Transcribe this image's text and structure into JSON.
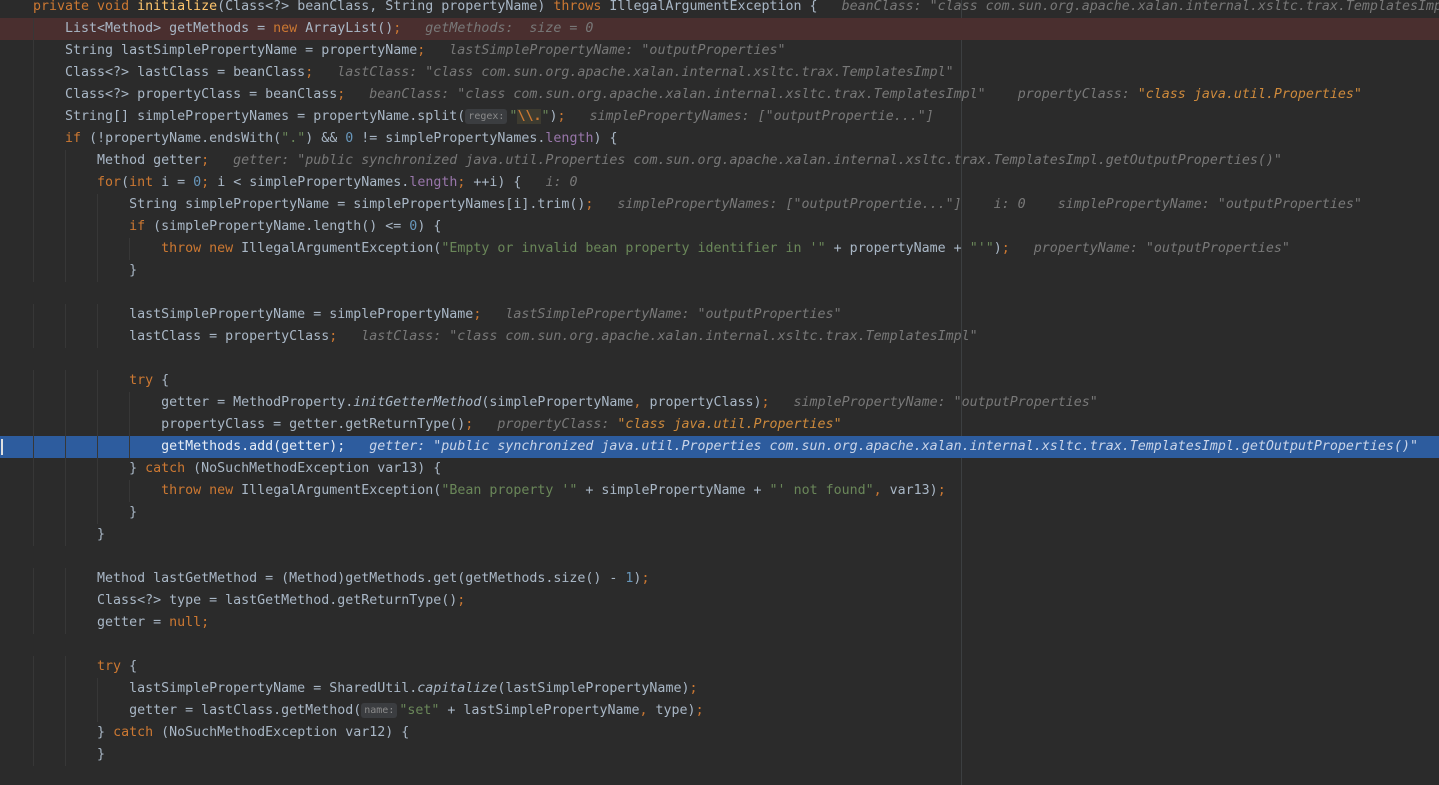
{
  "editor": {
    "lines": [
      [
        {
          "t": "private ",
          "c": "kw"
        },
        {
          "t": "void ",
          "c": "kw"
        },
        {
          "t": "initialize",
          "c": "fn"
        },
        {
          "t": "(Class<?> beanClass, String propertyName) "
        },
        {
          "t": "throws ",
          "c": "kw"
        },
        {
          "t": "IllegalArgumentException {"
        },
        {
          "t": "   beanClass: \"class com.sun.org.apache.xalan.internal.xsltc.trax.TemplatesImp",
          "c": "hint"
        }
      ],
      [
        {
          "t": "    List<Method> getMethods = "
        },
        {
          "t": "new ",
          "c": "kw"
        },
        {
          "t": "ArrayList()"
        },
        {
          "t": ";",
          "c": "punc"
        },
        {
          "t": "   getMethods:  size = 0",
          "c": "hint"
        }
      ],
      [
        {
          "t": "    String lastSimplePropertyName = propertyName"
        },
        {
          "t": ";",
          "c": "punc"
        },
        {
          "t": "   lastSimplePropertyName: \"outputProperties\"",
          "c": "hint"
        }
      ],
      [
        {
          "t": "    Class<?> lastClass = beanClass"
        },
        {
          "t": ";",
          "c": "punc"
        },
        {
          "t": "   lastClass: \"class com.sun.org.apache.xalan.internal.xsltc.trax.TemplatesImpl\"",
          "c": "hint"
        }
      ],
      [
        {
          "t": "    Class<?> propertyClass = beanClass"
        },
        {
          "t": ";",
          "c": "punc"
        },
        {
          "t": "   beanClass: \"class com.sun.org.apache.xalan.internal.xsltc.trax.TemplatesImpl\"    propertyClass: ",
          "c": "hint"
        },
        {
          "t": "\"class java.util.Properties\"",
          "c": "hint-val"
        }
      ],
      [
        {
          "t": "    String[] simplePropertyNames = propertyName.split("
        },
        {
          "t": "regex:",
          "c": "badge"
        },
        {
          "t": "\"",
          "c": "str"
        },
        {
          "t": "\\\\.",
          "c": "esc"
        },
        {
          "t": "\"",
          "c": "str"
        },
        {
          "t": ")"
        },
        {
          "t": ";",
          "c": "punc"
        },
        {
          "t": "   simplePropertyNames: [\"outputPropertie...\"]",
          "c": "hint"
        }
      ],
      [
        {
          "t": "    "
        },
        {
          "t": "if ",
          "c": "kw"
        },
        {
          "t": "(!propertyName.endsWith("
        },
        {
          "t": "\".\"",
          "c": "str"
        },
        {
          "t": ") && "
        },
        {
          "t": "0",
          "c": "num"
        },
        {
          "t": " != simplePropertyNames."
        },
        {
          "t": "length",
          "c": "fld"
        },
        {
          "t": ") {"
        }
      ],
      [
        {
          "t": "        Method getter"
        },
        {
          "t": ";",
          "c": "punc"
        },
        {
          "t": "   getter: \"public synchronized java.util.Properties com.sun.org.apache.xalan.internal.xsltc.trax.TemplatesImpl.getOutputProperties()\"",
          "c": "hint"
        }
      ],
      [
        {
          "t": "        "
        },
        {
          "t": "for",
          "c": "kw"
        },
        {
          "t": "("
        },
        {
          "t": "int ",
          "c": "kw"
        },
        {
          "t": "i = "
        },
        {
          "t": "0",
          "c": "num"
        },
        {
          "t": "; ",
          "c": "punc"
        },
        {
          "t": "i < simplePropertyNames."
        },
        {
          "t": "length",
          "c": "fld"
        },
        {
          "t": "; ",
          "c": "punc"
        },
        {
          "t": "++i) {"
        },
        {
          "t": "   i: 0",
          "c": "hint"
        }
      ],
      [
        {
          "t": "            String simplePropertyName = simplePropertyNames[i].trim()"
        },
        {
          "t": ";",
          "c": "punc"
        },
        {
          "t": "   simplePropertyNames: [\"outputPropertie...\"]    i: 0    simplePropertyName: \"outputProperties\"",
          "c": "hint"
        }
      ],
      [
        {
          "t": "            "
        },
        {
          "t": "if ",
          "c": "kw"
        },
        {
          "t": "(simplePropertyName.length() <= "
        },
        {
          "t": "0",
          "c": "num"
        },
        {
          "t": ") {"
        }
      ],
      [
        {
          "t": "                "
        },
        {
          "t": "throw ",
          "c": "kw"
        },
        {
          "t": "new ",
          "c": "kw"
        },
        {
          "t": "IllegalArgumentException("
        },
        {
          "t": "\"Empty or invalid bean property identifier in '\"",
          "c": "str"
        },
        {
          "t": " + propertyName + "
        },
        {
          "t": "\"'\"",
          "c": "str"
        },
        {
          "t": ")"
        },
        {
          "t": ";",
          "c": "punc"
        },
        {
          "t": "   propertyName: \"outputProperties\"",
          "c": "hint"
        }
      ],
      [
        {
          "t": "            }"
        }
      ],
      [
        {
          "t": ""
        }
      ],
      [
        {
          "t": "            lastSimplePropertyName = simplePropertyName"
        },
        {
          "t": ";",
          "c": "punc"
        },
        {
          "t": "   lastSimplePropertyName: \"outputProperties\"",
          "c": "hint"
        }
      ],
      [
        {
          "t": "            lastClass = propertyClass"
        },
        {
          "t": ";",
          "c": "punc"
        },
        {
          "t": "   lastClass: \"class com.sun.org.apache.xalan.internal.xsltc.trax.TemplatesImpl\"",
          "c": "hint"
        }
      ],
      [
        {
          "t": ""
        }
      ],
      [
        {
          "t": "            "
        },
        {
          "t": "try ",
          "c": "kw"
        },
        {
          "t": "{"
        }
      ],
      [
        {
          "t": "                getter = MethodProperty."
        },
        {
          "t": "initGetterMethod",
          "c": "it"
        },
        {
          "t": "(simplePropertyName"
        },
        {
          "t": ", ",
          "c": "punc"
        },
        {
          "t": "propertyClass)"
        },
        {
          "t": ";",
          "c": "punc"
        },
        {
          "t": "   simplePropertyName: \"outputProperties\"",
          "c": "hint"
        }
      ],
      [
        {
          "t": "                propertyClass = getter.getReturnType()"
        },
        {
          "t": ";",
          "c": "punc"
        },
        {
          "t": "   propertyClass: ",
          "c": "hint"
        },
        {
          "t": "\"class java.util.Properties\"",
          "c": "hint-val"
        }
      ],
      [
        {
          "t": "                getMethods.add(getter)"
        },
        {
          "t": ";",
          "c": "punc"
        },
        {
          "t": "   getter: \"public synchronized java.util.Properties com.sun.org.apache.xalan.internal.xsltc.trax.TemplatesImpl.getOutputProperties()\"",
          "c": "hint"
        }
      ],
      [
        {
          "t": "            } "
        },
        {
          "t": "catch ",
          "c": "kw"
        },
        {
          "t": "(NoSuchMethodException var13) {"
        }
      ],
      [
        {
          "t": "                "
        },
        {
          "t": "throw ",
          "c": "kw"
        },
        {
          "t": "new ",
          "c": "kw"
        },
        {
          "t": "IllegalArgumentException("
        },
        {
          "t": "\"Bean property '\"",
          "c": "str"
        },
        {
          "t": " + simplePropertyName + "
        },
        {
          "t": "\"' not found\"",
          "c": "str"
        },
        {
          "t": ", ",
          "c": "punc"
        },
        {
          "t": "var13)"
        },
        {
          "t": ";",
          "c": "punc"
        }
      ],
      [
        {
          "t": "            }"
        }
      ],
      [
        {
          "t": "        }"
        }
      ],
      [
        {
          "t": ""
        }
      ],
      [
        {
          "t": "        Method lastGetMethod = (Method)getMethods.get(getMethods.size() - "
        },
        {
          "t": "1",
          "c": "num"
        },
        {
          "t": ")"
        },
        {
          "t": ";",
          "c": "punc"
        }
      ],
      [
        {
          "t": "        Class<?> type = lastGetMethod.getReturnType()"
        },
        {
          "t": ";",
          "c": "punc"
        }
      ],
      [
        {
          "t": "        getter = "
        },
        {
          "t": "null",
          "c": "kw"
        },
        {
          "t": ";",
          "c": "punc"
        }
      ],
      [
        {
          "t": ""
        }
      ],
      [
        {
          "t": "        "
        },
        {
          "t": "try ",
          "c": "kw"
        },
        {
          "t": "{"
        }
      ],
      [
        {
          "t": "            lastSimplePropertyName = SharedUtil."
        },
        {
          "t": "capitalize",
          "c": "it"
        },
        {
          "t": "(lastSimplePropertyName)"
        },
        {
          "t": ";",
          "c": "punc"
        }
      ],
      [
        {
          "t": "            getter = lastClass.getMethod("
        },
        {
          "t": "name:",
          "c": "badge"
        },
        {
          "t": "\"set\"",
          "c": "str"
        },
        {
          "t": " + lastSimplePropertyName"
        },
        {
          "t": ", ",
          "c": "punc"
        },
        {
          "t": "type)"
        },
        {
          "t": ";",
          "c": "punc"
        }
      ],
      [
        {
          "t": "        } "
        },
        {
          "t": "catch ",
          "c": "kw"
        },
        {
          "t": "(NoSuchMethodException var12) {"
        }
      ],
      [
        {
          "t": "        }"
        }
      ]
    ]
  }
}
